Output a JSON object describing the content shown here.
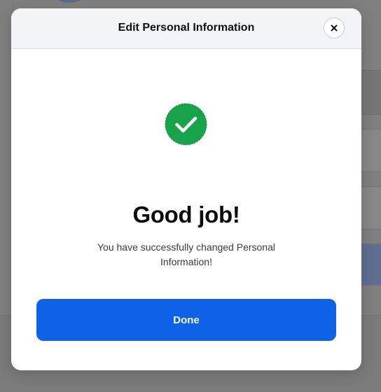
{
  "modal": {
    "title": "Edit Personal Information",
    "close_icon": "close-icon",
    "success_icon": "check-circle-icon",
    "success_color": "#16a34a",
    "headline": "Good job!",
    "message": "You have successfully changed Personal Information!",
    "done_label": "Done",
    "done_color": "#0d62e8"
  }
}
